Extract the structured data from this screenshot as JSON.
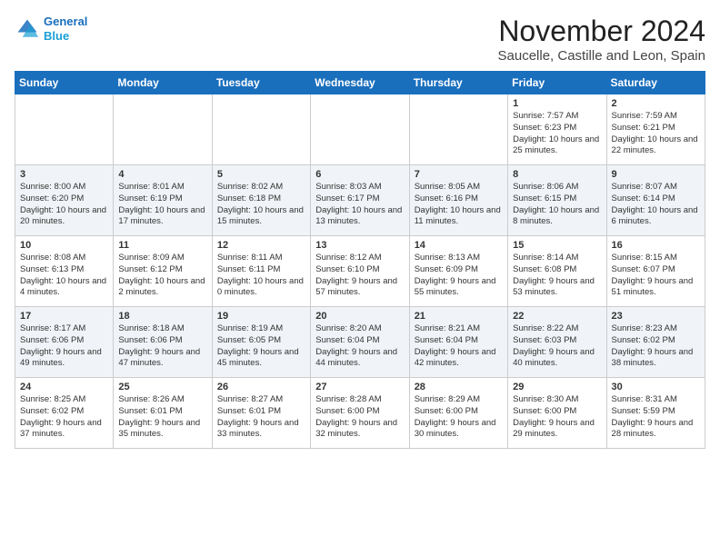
{
  "header": {
    "logo_line1": "General",
    "logo_line2": "Blue",
    "month": "November 2024",
    "location": "Saucelle, Castille and Leon, Spain"
  },
  "days_of_week": [
    "Sunday",
    "Monday",
    "Tuesday",
    "Wednesday",
    "Thursday",
    "Friday",
    "Saturday"
  ],
  "weeks": [
    [
      {
        "day": "",
        "info": ""
      },
      {
        "day": "",
        "info": ""
      },
      {
        "day": "",
        "info": ""
      },
      {
        "day": "",
        "info": ""
      },
      {
        "day": "",
        "info": ""
      },
      {
        "day": "1",
        "info": "Sunrise: 7:57 AM\nSunset: 6:23 PM\nDaylight: 10 hours and 25 minutes."
      },
      {
        "day": "2",
        "info": "Sunrise: 7:59 AM\nSunset: 6:21 PM\nDaylight: 10 hours and 22 minutes."
      }
    ],
    [
      {
        "day": "3",
        "info": "Sunrise: 8:00 AM\nSunset: 6:20 PM\nDaylight: 10 hours and 20 minutes."
      },
      {
        "day": "4",
        "info": "Sunrise: 8:01 AM\nSunset: 6:19 PM\nDaylight: 10 hours and 17 minutes."
      },
      {
        "day": "5",
        "info": "Sunrise: 8:02 AM\nSunset: 6:18 PM\nDaylight: 10 hours and 15 minutes."
      },
      {
        "day": "6",
        "info": "Sunrise: 8:03 AM\nSunset: 6:17 PM\nDaylight: 10 hours and 13 minutes."
      },
      {
        "day": "7",
        "info": "Sunrise: 8:05 AM\nSunset: 6:16 PM\nDaylight: 10 hours and 11 minutes."
      },
      {
        "day": "8",
        "info": "Sunrise: 8:06 AM\nSunset: 6:15 PM\nDaylight: 10 hours and 8 minutes."
      },
      {
        "day": "9",
        "info": "Sunrise: 8:07 AM\nSunset: 6:14 PM\nDaylight: 10 hours and 6 minutes."
      }
    ],
    [
      {
        "day": "10",
        "info": "Sunrise: 8:08 AM\nSunset: 6:13 PM\nDaylight: 10 hours and 4 minutes."
      },
      {
        "day": "11",
        "info": "Sunrise: 8:09 AM\nSunset: 6:12 PM\nDaylight: 10 hours and 2 minutes."
      },
      {
        "day": "12",
        "info": "Sunrise: 8:11 AM\nSunset: 6:11 PM\nDaylight: 10 hours and 0 minutes."
      },
      {
        "day": "13",
        "info": "Sunrise: 8:12 AM\nSunset: 6:10 PM\nDaylight: 9 hours and 57 minutes."
      },
      {
        "day": "14",
        "info": "Sunrise: 8:13 AM\nSunset: 6:09 PM\nDaylight: 9 hours and 55 minutes."
      },
      {
        "day": "15",
        "info": "Sunrise: 8:14 AM\nSunset: 6:08 PM\nDaylight: 9 hours and 53 minutes."
      },
      {
        "day": "16",
        "info": "Sunrise: 8:15 AM\nSunset: 6:07 PM\nDaylight: 9 hours and 51 minutes."
      }
    ],
    [
      {
        "day": "17",
        "info": "Sunrise: 8:17 AM\nSunset: 6:06 PM\nDaylight: 9 hours and 49 minutes."
      },
      {
        "day": "18",
        "info": "Sunrise: 8:18 AM\nSunset: 6:06 PM\nDaylight: 9 hours and 47 minutes."
      },
      {
        "day": "19",
        "info": "Sunrise: 8:19 AM\nSunset: 6:05 PM\nDaylight: 9 hours and 45 minutes."
      },
      {
        "day": "20",
        "info": "Sunrise: 8:20 AM\nSunset: 6:04 PM\nDaylight: 9 hours and 44 minutes."
      },
      {
        "day": "21",
        "info": "Sunrise: 8:21 AM\nSunset: 6:04 PM\nDaylight: 9 hours and 42 minutes."
      },
      {
        "day": "22",
        "info": "Sunrise: 8:22 AM\nSunset: 6:03 PM\nDaylight: 9 hours and 40 minutes."
      },
      {
        "day": "23",
        "info": "Sunrise: 8:23 AM\nSunset: 6:02 PM\nDaylight: 9 hours and 38 minutes."
      }
    ],
    [
      {
        "day": "24",
        "info": "Sunrise: 8:25 AM\nSunset: 6:02 PM\nDaylight: 9 hours and 37 minutes."
      },
      {
        "day": "25",
        "info": "Sunrise: 8:26 AM\nSunset: 6:01 PM\nDaylight: 9 hours and 35 minutes."
      },
      {
        "day": "26",
        "info": "Sunrise: 8:27 AM\nSunset: 6:01 PM\nDaylight: 9 hours and 33 minutes."
      },
      {
        "day": "27",
        "info": "Sunrise: 8:28 AM\nSunset: 6:00 PM\nDaylight: 9 hours and 32 minutes."
      },
      {
        "day": "28",
        "info": "Sunrise: 8:29 AM\nSunset: 6:00 PM\nDaylight: 9 hours and 30 minutes."
      },
      {
        "day": "29",
        "info": "Sunrise: 8:30 AM\nSunset: 6:00 PM\nDaylight: 9 hours and 29 minutes."
      },
      {
        "day": "30",
        "info": "Sunrise: 8:31 AM\nSunset: 5:59 PM\nDaylight: 9 hours and 28 minutes."
      }
    ]
  ]
}
